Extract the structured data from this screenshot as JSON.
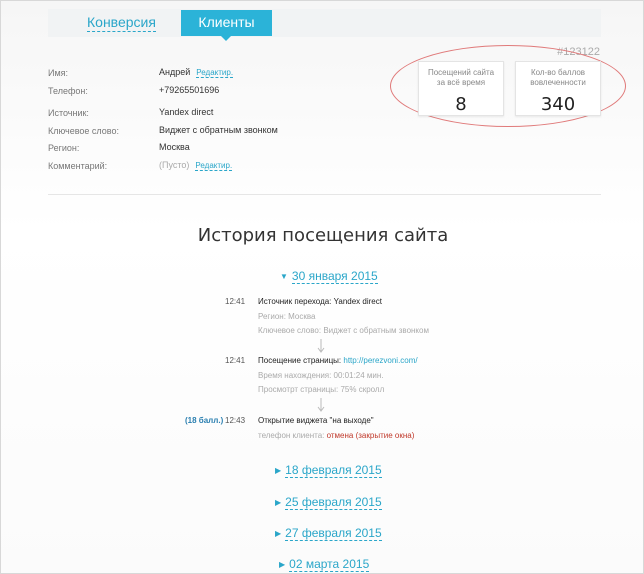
{
  "tabs": {
    "conversion": "Конверсия",
    "clients": "Клиенты"
  },
  "client": {
    "id": "#123122",
    "fields": [
      {
        "label": "Имя:",
        "value": "Андрей",
        "edit": "Редактир."
      },
      {
        "label": "Телефон:",
        "value": "+79265501696"
      },
      {
        "label": "Источник:",
        "value": "Yandex direct"
      },
      {
        "label": "Ключевое слово:",
        "value": "Виджет с обратным звонком"
      },
      {
        "label": "Регион:",
        "value": "Москва"
      },
      {
        "label": "Комментарий:",
        "value": "(Пусто)",
        "edit": "Редактир."
      }
    ]
  },
  "stats": [
    {
      "label": "Посещений сайта за всё время",
      "value": "8"
    },
    {
      "label": "Кол-во баллов вовлеченности",
      "value": "340"
    }
  ],
  "history": {
    "title": "История посещения сайта",
    "expanded_date": "30 января 2015",
    "events": [
      {
        "time": "12:41",
        "main": "Источник перехода: Yandex direct",
        "subs": [
          "Регион: Москва",
          "Ключевое слово: Виджет с обратным звонком"
        ]
      },
      {
        "time": "12:41",
        "main_prefix": "Посещение страницы: ",
        "main_link": "http://perezvoni.com/",
        "subs": [
          "Время нахождения: 00:01:24 мин.",
          "Просмотрт страницы: 75% скролл"
        ]
      },
      {
        "points": "(18 балл.)",
        "time": "12:43",
        "main": "Открытие виджета \"на выходе\"",
        "sub_prefix": "телефон клиента: ",
        "sub_red": "отмена (закрытие окна)"
      }
    ],
    "collapsed_dates": [
      "18 февраля 2015",
      "25 февраля 2015",
      "27 февраля 2015",
      "02 марта 2015"
    ]
  },
  "colors": {
    "accent": "#2bb3d8",
    "link": "#2aa6c9",
    "highlight": "#e07a7a",
    "danger": "#c0392b"
  }
}
